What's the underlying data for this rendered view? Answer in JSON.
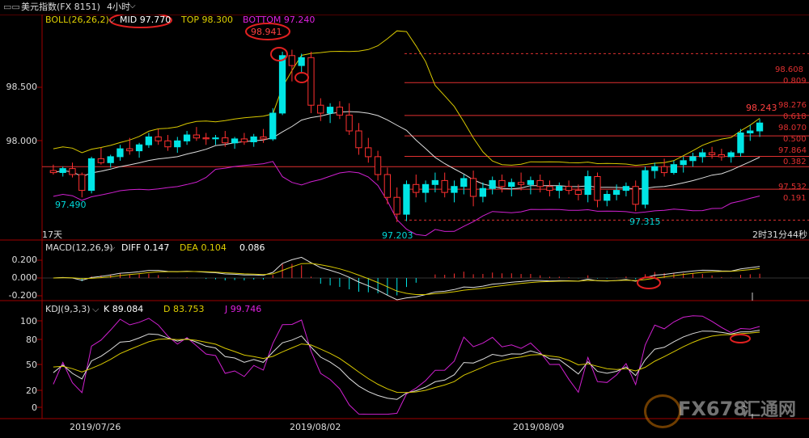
{
  "header": {
    "title": "美元指数(FX 8151)",
    "period": "4小时",
    "window_icon": "window-icon",
    "dropdown_icon": "chevron-down-icon"
  },
  "boll": {
    "label": "BOLL(26,26,2)",
    "mid": "MID 97.770",
    "top": "TOP 98.300",
    "bottom": "BOTTOM 97.240",
    "price_labels": [
      "98.500",
      "98.000"
    ],
    "annotations": [
      "98.941",
      "97.490",
      "97.203",
      "97.315",
      "98.243"
    ],
    "period_tag": "17天",
    "countdown": "2时31分44秒",
    "fib_levels": [
      "98.608",
      "0.809",
      "98.276",
      "0.618",
      "98.070",
      "0.500",
      "97.864",
      "0.382",
      "97.532",
      "0.191"
    ]
  },
  "macd": {
    "label": "MACD(12,26,9)",
    "diff": "DIFF 0.147",
    "dea": "DEA 0.104",
    "value": "0.086",
    "axis_labels": [
      "0.200",
      "0.000",
      "-0.200"
    ]
  },
  "kdj": {
    "label": "KDJ(9,3,3)",
    "k": "K 89.084",
    "d": "D 83.753",
    "j": "J 99.746",
    "axis_labels": [
      "100",
      "80",
      "50",
      "20",
      "0"
    ]
  },
  "dates": [
    "2019/07/26",
    "2019/08/02",
    "2019/08/09"
  ],
  "watermark": {
    "brand": "FX678",
    "cn": "汇通网"
  },
  "colors": {
    "up": "#00e5e5",
    "down": "#ff3030",
    "ma_white": "#dddddd",
    "boll_yellow": "#d8c800",
    "boll_magenta": "#d020d0",
    "fib_red": "#e03030",
    "axis_border": "#a00000"
  },
  "chart_data": {
    "type": "candlestick",
    "instrument": "美元指数(FX 8151)",
    "timeframe": "4小时",
    "ylim": [
      97.15,
      99.05
    ],
    "candles": [
      {
        "o": 97.72,
        "h": 97.78,
        "l": 97.68,
        "c": 97.7
      },
      {
        "o": 97.7,
        "h": 97.76,
        "l": 97.66,
        "c": 97.74
      },
      {
        "o": 97.74,
        "h": 97.8,
        "l": 97.65,
        "c": 97.68
      },
      {
        "o": 97.68,
        "h": 97.7,
        "l": 97.45,
        "c": 97.52
      },
      {
        "o": 97.52,
        "h": 97.86,
        "l": 97.49,
        "c": 97.84
      },
      {
        "o": 97.84,
        "h": 97.95,
        "l": 97.78,
        "c": 97.8
      },
      {
        "o": 97.8,
        "h": 97.88,
        "l": 97.75,
        "c": 97.86
      },
      {
        "o": 97.86,
        "h": 97.98,
        "l": 97.82,
        "c": 97.94
      },
      {
        "o": 97.94,
        "h": 98.05,
        "l": 97.88,
        "c": 97.92
      },
      {
        "o": 97.92,
        "h": 98.0,
        "l": 97.85,
        "c": 97.98
      },
      {
        "o": 97.98,
        "h": 98.1,
        "l": 97.95,
        "c": 98.06
      },
      {
        "o": 98.06,
        "h": 98.14,
        "l": 97.98,
        "c": 98.02
      },
      {
        "o": 98.02,
        "h": 98.08,
        "l": 97.92,
        "c": 97.96
      },
      {
        "o": 97.96,
        "h": 98.06,
        "l": 97.9,
        "c": 98.02
      },
      {
        "o": 98.02,
        "h": 98.12,
        "l": 97.98,
        "c": 98.08
      },
      {
        "o": 98.08,
        "h": 98.16,
        "l": 98.02,
        "c": 98.05
      },
      {
        "o": 98.05,
        "h": 98.1,
        "l": 97.98,
        "c": 98.04
      },
      {
        "o": 98.04,
        "h": 98.08,
        "l": 97.98,
        "c": 98.05
      },
      {
        "o": 98.05,
        "h": 98.12,
        "l": 97.96,
        "c": 98.0
      },
      {
        "o": 98.0,
        "h": 98.06,
        "l": 97.94,
        "c": 98.04
      },
      {
        "o": 98.04,
        "h": 98.1,
        "l": 97.98,
        "c": 98.01
      },
      {
        "o": 98.01,
        "h": 98.09,
        "l": 97.96,
        "c": 98.06
      },
      {
        "o": 98.06,
        "h": 98.14,
        "l": 98.0,
        "c": 98.04
      },
      {
        "o": 98.04,
        "h": 98.35,
        "l": 98.02,
        "c": 98.3
      },
      {
        "o": 98.3,
        "h": 98.92,
        "l": 98.28,
        "c": 98.88
      },
      {
        "o": 98.88,
        "h": 98.94,
        "l": 98.62,
        "c": 98.78
      },
      {
        "o": 98.78,
        "h": 98.9,
        "l": 98.7,
        "c": 98.86
      },
      {
        "o": 98.86,
        "h": 98.92,
        "l": 98.3,
        "c": 98.38
      },
      {
        "o": 98.38,
        "h": 98.45,
        "l": 98.22,
        "c": 98.3
      },
      {
        "o": 98.3,
        "h": 98.4,
        "l": 98.2,
        "c": 98.36
      },
      {
        "o": 98.36,
        "h": 98.42,
        "l": 98.24,
        "c": 98.28
      },
      {
        "o": 98.28,
        "h": 98.4,
        "l": 98.08,
        "c": 98.12
      },
      {
        "o": 98.12,
        "h": 98.2,
        "l": 97.88,
        "c": 97.95
      },
      {
        "o": 97.95,
        "h": 98.05,
        "l": 97.8,
        "c": 97.86
      },
      {
        "o": 97.86,
        "h": 97.92,
        "l": 97.62,
        "c": 97.68
      },
      {
        "o": 97.68,
        "h": 97.75,
        "l": 97.38,
        "c": 97.45
      },
      {
        "o": 97.45,
        "h": 97.55,
        "l": 97.2,
        "c": 97.28
      },
      {
        "o": 97.28,
        "h": 97.62,
        "l": 97.21,
        "c": 97.58
      },
      {
        "o": 97.58,
        "h": 97.68,
        "l": 97.45,
        "c": 97.5
      },
      {
        "o": 97.5,
        "h": 97.62,
        "l": 97.4,
        "c": 97.58
      },
      {
        "o": 97.58,
        "h": 97.7,
        "l": 97.5,
        "c": 97.62
      },
      {
        "o": 97.62,
        "h": 97.7,
        "l": 97.45,
        "c": 97.5
      },
      {
        "o": 97.5,
        "h": 97.62,
        "l": 97.4,
        "c": 97.56
      },
      {
        "o": 97.56,
        "h": 97.68,
        "l": 97.48,
        "c": 97.64
      },
      {
        "o": 97.64,
        "h": 97.72,
        "l": 97.36,
        "c": 97.46
      },
      {
        "o": 97.46,
        "h": 97.6,
        "l": 97.4,
        "c": 97.54
      },
      {
        "o": 97.54,
        "h": 97.66,
        "l": 97.48,
        "c": 97.62
      },
      {
        "o": 97.62,
        "h": 97.68,
        "l": 97.5,
        "c": 97.56
      },
      {
        "o": 97.56,
        "h": 97.64,
        "l": 97.46,
        "c": 97.6
      },
      {
        "o": 97.6,
        "h": 97.7,
        "l": 97.52,
        "c": 97.58
      },
      {
        "o": 97.58,
        "h": 97.66,
        "l": 97.48,
        "c": 97.62
      },
      {
        "o": 97.62,
        "h": 97.68,
        "l": 97.5,
        "c": 97.56
      },
      {
        "o": 97.56,
        "h": 97.62,
        "l": 97.46,
        "c": 97.52
      },
      {
        "o": 97.52,
        "h": 97.6,
        "l": 97.44,
        "c": 97.56
      },
      {
        "o": 97.56,
        "h": 97.62,
        "l": 97.48,
        "c": 97.52
      },
      {
        "o": 97.52,
        "h": 97.58,
        "l": 97.42,
        "c": 97.48
      },
      {
        "o": 97.48,
        "h": 97.72,
        "l": 97.4,
        "c": 97.66
      },
      {
        "o": 97.66,
        "h": 97.7,
        "l": 97.35,
        "c": 97.42
      },
      {
        "o": 97.42,
        "h": 97.52,
        "l": 97.36,
        "c": 97.48
      },
      {
        "o": 97.48,
        "h": 97.58,
        "l": 97.42,
        "c": 97.52
      },
      {
        "o": 97.52,
        "h": 97.6,
        "l": 97.46,
        "c": 97.56
      },
      {
        "o": 97.56,
        "h": 97.62,
        "l": 97.31,
        "c": 97.38
      },
      {
        "o": 97.38,
        "h": 97.76,
        "l": 97.34,
        "c": 97.72
      },
      {
        "o": 97.72,
        "h": 97.8,
        "l": 97.64,
        "c": 97.76
      },
      {
        "o": 97.76,
        "h": 97.84,
        "l": 97.66,
        "c": 97.7
      },
      {
        "o": 97.7,
        "h": 97.82,
        "l": 97.68,
        "c": 97.78
      },
      {
        "o": 97.78,
        "h": 97.86,
        "l": 97.7,
        "c": 97.82
      },
      {
        "o": 97.82,
        "h": 97.9,
        "l": 97.76,
        "c": 97.86
      },
      {
        "o": 97.86,
        "h": 97.94,
        "l": 97.8,
        "c": 97.9
      },
      {
        "o": 97.9,
        "h": 97.96,
        "l": 97.84,
        "c": 97.88
      },
      {
        "o": 97.88,
        "h": 97.94,
        "l": 97.82,
        "c": 97.86
      },
      {
        "o": 97.86,
        "h": 97.92,
        "l": 97.8,
        "c": 97.9
      },
      {
        "o": 97.9,
        "h": 98.14,
        "l": 97.86,
        "c": 98.1
      },
      {
        "o": 98.1,
        "h": 98.18,
        "l": 98.02,
        "c": 98.12
      },
      {
        "o": 98.12,
        "h": 98.24,
        "l": 98.06,
        "c": 98.2
      }
    ],
    "boll_mid_label": "MID 97.770",
    "boll_top_label": "TOP 98.300",
    "boll_bottom_label": "BOTTOM 97.240",
    "fibonacci": [
      {
        "price": 98.608,
        "ratio": 0.809
      },
      {
        "price": 98.276,
        "ratio": 0.618
      },
      {
        "price": 98.07,
        "ratio": 0.5
      },
      {
        "price": 97.864,
        "ratio": 0.382
      },
      {
        "price": 97.532,
        "ratio": 0.191
      }
    ],
    "macd": {
      "diff": 0.147,
      "dea": 0.104,
      "macd": 0.086,
      "ylim": [
        -0.25,
        0.25
      ]
    },
    "kdj": {
      "k": 89.084,
      "d": 83.753,
      "j": 99.746,
      "ylim": [
        -10,
        110
      ]
    },
    "x_labels": [
      "2019/07/26",
      "2019/08/02",
      "2019/08/09"
    ]
  }
}
